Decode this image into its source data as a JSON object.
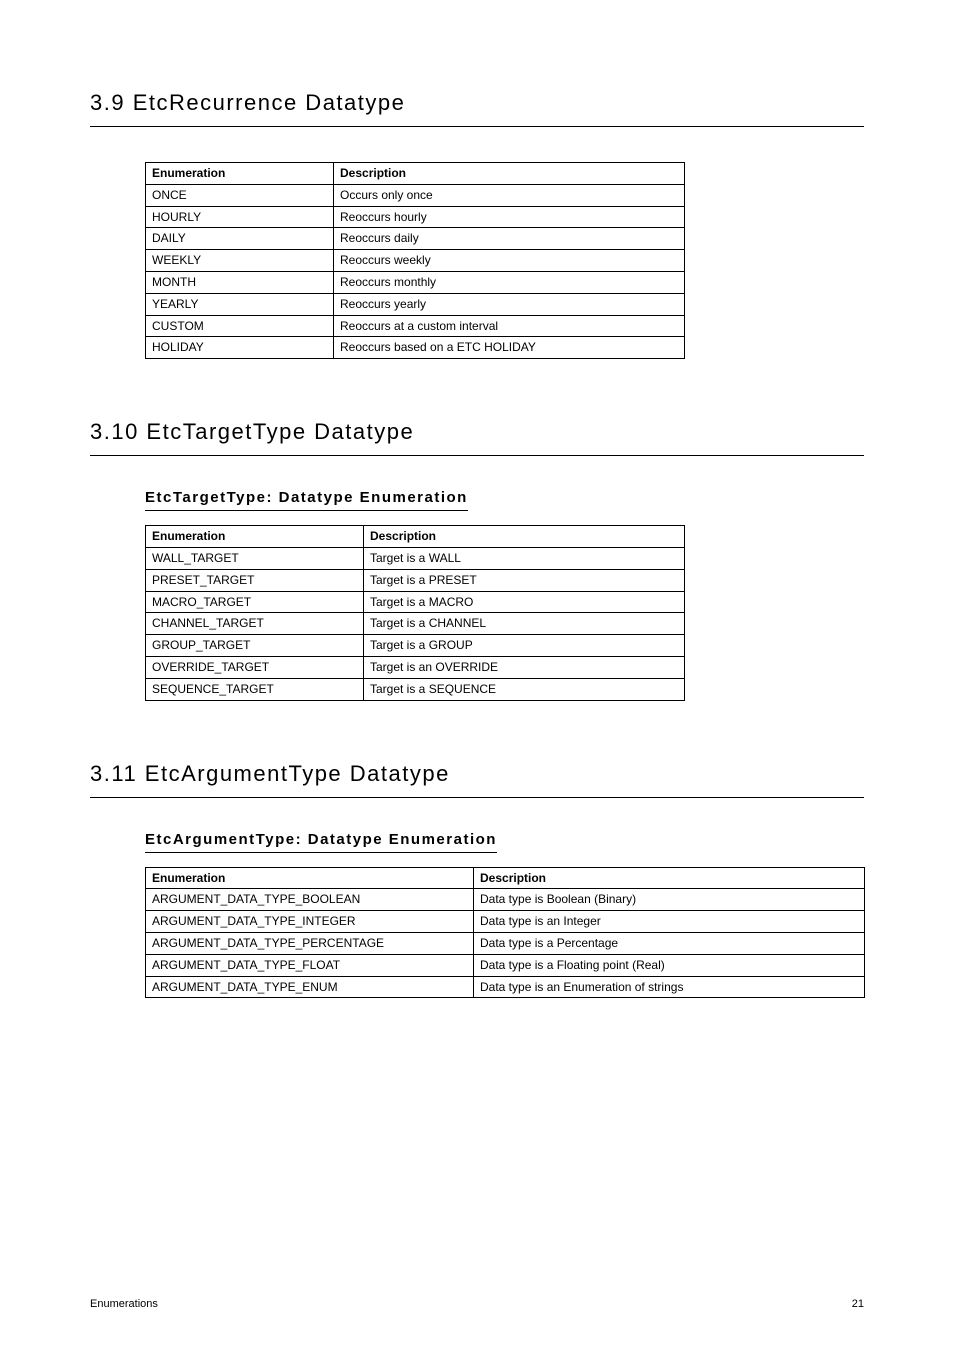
{
  "section1": {
    "title": "3.9 EtcRecurrence Datatype",
    "table": {
      "header": [
        "Enumeration",
        "Description"
      ],
      "rows": [
        [
          "ONCE",
          "Occurs only once"
        ],
        [
          "HOURLY",
          "Reoccurs hourly"
        ],
        [
          "DAILY",
          "Reoccurs daily"
        ],
        [
          "WEEKLY",
          "Reoccurs weekly"
        ],
        [
          "MONTH",
          "Reoccurs monthly"
        ],
        [
          "YEARLY",
          "Reoccurs yearly"
        ],
        [
          "CUSTOM",
          "Reoccurs at a custom interval"
        ],
        [
          "HOLIDAY",
          "Reoccurs based on a ETC HOLIDAY"
        ]
      ]
    }
  },
  "section2": {
    "title": "3.10 EtcTargetType Datatype",
    "subtitle": "EtcTargetType: Datatype Enumeration",
    "table": {
      "header": [
        "Enumeration",
        "Description"
      ],
      "rows": [
        [
          "WALL_TARGET",
          "Target is a WALL"
        ],
        [
          "PRESET_TARGET",
          "Target is a PRESET"
        ],
        [
          "MACRO_TARGET",
          "Target is a MACRO"
        ],
        [
          "CHANNEL_TARGET",
          "Target is a CHANNEL"
        ],
        [
          "GROUP_TARGET",
          "Target is a GROUP"
        ],
        [
          "OVERRIDE_TARGET",
          "Target is an OVERRIDE"
        ],
        [
          "SEQUENCE_TARGET",
          "Target is a SEQUENCE"
        ]
      ]
    }
  },
  "section3": {
    "title": "3.11 EtcArgumentType Datatype",
    "subtitle": "EtcArgumentType: Datatype Enumeration",
    "table": {
      "header": [
        "Enumeration",
        "Description"
      ],
      "rows": [
        [
          "ARGUMENT_DATA_TYPE_BOOLEAN",
          "Data type is Boolean (Binary)"
        ],
        [
          "ARGUMENT_DATA_TYPE_INTEGER",
          "Data type is an Integer"
        ],
        [
          "ARGUMENT_DATA_TYPE_PERCENTAGE",
          "Data type is a Percentage"
        ],
        [
          "ARGUMENT_DATA_TYPE_FLOAT",
          "Data type is a Floating point (Real)"
        ],
        [
          "ARGUMENT_DATA_TYPE_ENUM",
          "Data type is an Enumeration of strings"
        ]
      ]
    }
  },
  "footer": {
    "left": "Enumerations",
    "right": "21"
  }
}
